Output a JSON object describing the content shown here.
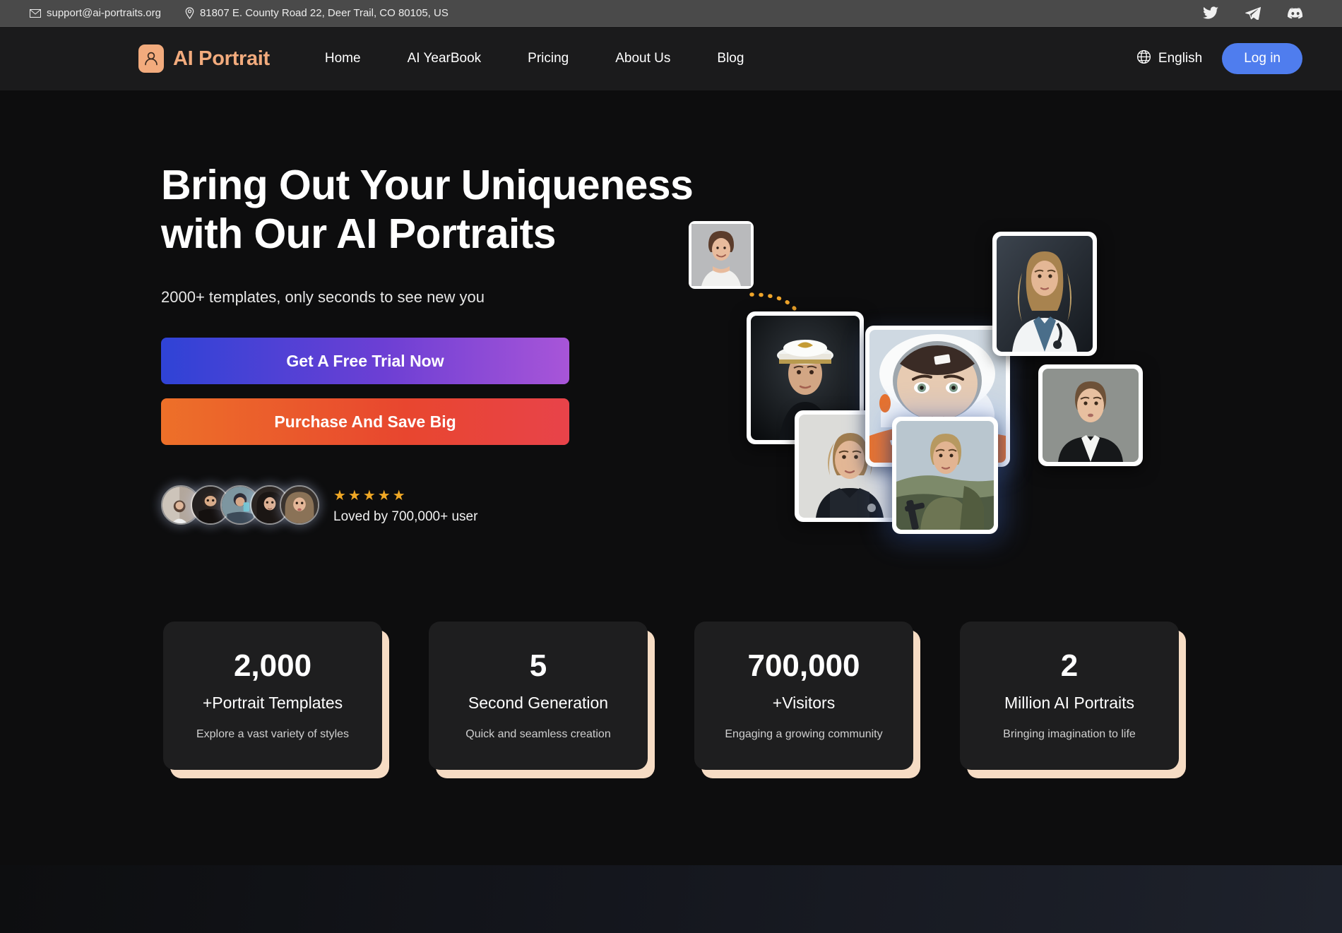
{
  "topbar": {
    "email": "support@ai-portraits.org",
    "email_icon": "envelope-icon",
    "address": "81807 E. County Road 22, Deer Trail, CO 80105, US",
    "address_icon": "map-pin-icon",
    "socials": [
      {
        "name": "twitter-icon",
        "label": "Twitter"
      },
      {
        "name": "telegram-icon",
        "label": "Telegram"
      },
      {
        "name": "discord-icon",
        "label": "Discord"
      }
    ]
  },
  "nav": {
    "brand": "AI Portrait",
    "brand_icon": "user-avatar-icon",
    "brand_color": "#f2ab7d",
    "links": [
      {
        "label": "Home"
      },
      {
        "label": "AI YearBook"
      },
      {
        "label": "Pricing"
      },
      {
        "label": "About Us"
      },
      {
        "label": "Blog"
      }
    ],
    "language": "English",
    "language_icon": "globe-icon",
    "login_label": "Log in",
    "login_color": "#4f7dee"
  },
  "hero": {
    "headline_line1": "Bring Out Your Uniqueness",
    "headline_line2": "with Our AI Portraits",
    "subhead": "2000+ templates, only seconds to see new you",
    "cta_primary": "Get A Free Trial Now",
    "cta_primary_colors": [
      "#2f43d6",
      "#a855d8"
    ],
    "cta_secondary": "Purchase And Save Big",
    "cta_secondary_colors": [
      "#ed7029",
      "#e8434a"
    ],
    "stars": "★★★★★",
    "stars_color": "#f0a825",
    "proof_label": "Loved by 700,000+ user",
    "avatar_count": 5,
    "arrow_icon": "curved-dashed-arrow-icon",
    "arrow_color": "#f0a52a"
  },
  "stats": [
    {
      "value": "2,000",
      "label": "+Portrait Templates",
      "desc": "Explore a vast variety of styles"
    },
    {
      "value": "5",
      "label": "Second Generation",
      "desc": "Quick and seamless creation"
    },
    {
      "value": "700,000",
      "label": "+Visitors",
      "desc": "Engaging a growing community"
    },
    {
      "value": "2",
      "label": "Million AI Portraits",
      "desc": "Bringing imagination to life"
    }
  ]
}
